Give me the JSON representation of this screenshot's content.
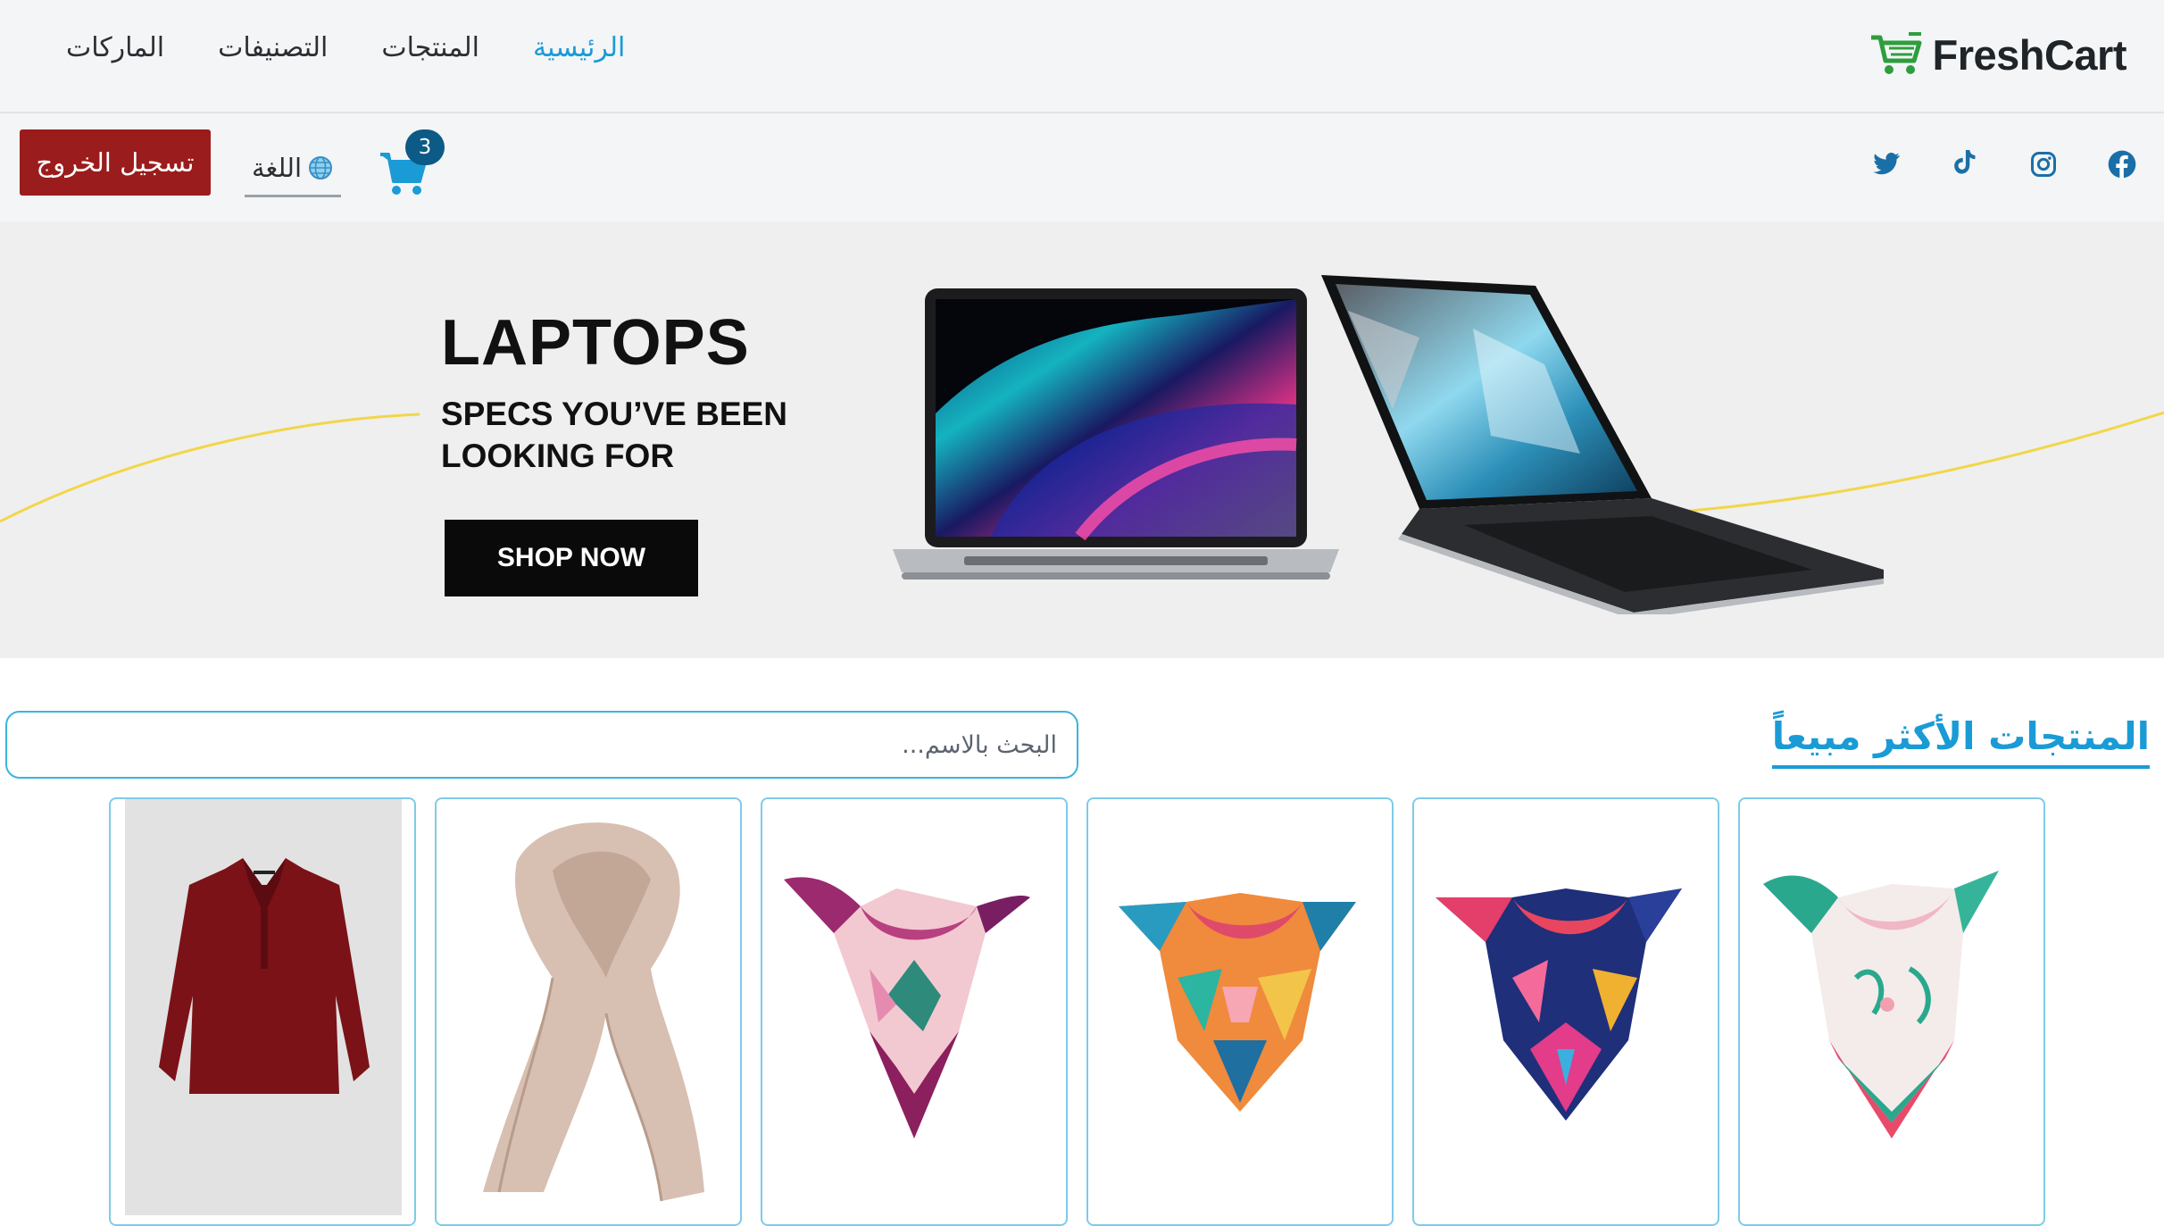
{
  "brand": {
    "name": "FreshCart",
    "icon": "cart-logo-icon",
    "color": "#2e9e3d"
  },
  "nav": {
    "links": [
      {
        "label": "الرئيسية",
        "active": true
      },
      {
        "label": "المنتجات",
        "active": false
      },
      {
        "label": "التصنيفات",
        "active": false
      },
      {
        "label": "الماركات",
        "active": false
      }
    ]
  },
  "subbar": {
    "logout_label": "تسجيل الخروج",
    "language_label": "اللغة",
    "cart_count": "3",
    "socials": [
      "facebook-icon",
      "instagram-icon",
      "tiktok-icon",
      "twitter-icon"
    ]
  },
  "hero": {
    "title": "LAPTOPS",
    "subtitle": "SPECS YOU’VE BEEN LOOKING FOR",
    "button": "SHOP NOW"
  },
  "section": {
    "title": "المنتجات الأكثر مبيعاً",
    "search_placeholder": "البحث بالاسم..."
  },
  "products": [
    {
      "name": "red-blouse",
      "image": "shirt"
    },
    {
      "name": "beige-scarf",
      "image": "long-scarf"
    },
    {
      "name": "pink-purple-scarf",
      "image": "square-scarf"
    },
    {
      "name": "orange-blue-scarf",
      "image": "square-scarf"
    },
    {
      "name": "navy-pink-scarf",
      "image": "square-scarf"
    },
    {
      "name": "white-green-scarf",
      "image": "square-scarf"
    }
  ],
  "colors": {
    "accent": "#1a9bd6",
    "logout": "#9b1c1c",
    "badge": "#0c5a86"
  }
}
